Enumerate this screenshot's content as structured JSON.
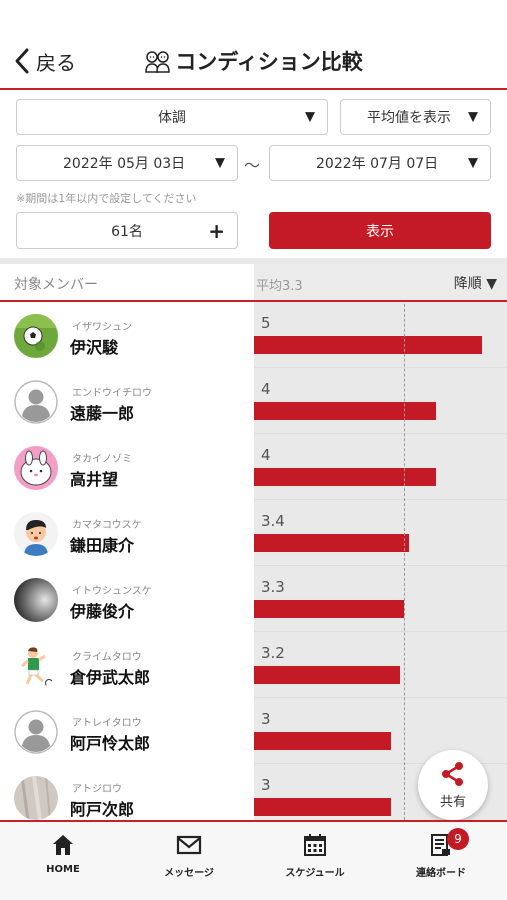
{
  "header": {
    "back_label": "戻る",
    "title": "コンディション比較"
  },
  "filters": {
    "metric": "体調",
    "display_mode": "平均値を表示",
    "date_from": "2022年 05月 03日",
    "date_to": "2022年 07月 07日",
    "separator": "〜",
    "note": "※期間は1年以内で設定してください",
    "members": "61名",
    "show_button": "表示"
  },
  "table": {
    "col_member": "対象メンバー",
    "col_average": "平均3.3",
    "sort_label": "降順 ▼",
    "average": 3.3,
    "max_value": 5
  },
  "members": [
    {
      "kana": "イザワシュン",
      "name": "伊沢駿",
      "value": "5",
      "avatar": "soccer-ball-photo"
    },
    {
      "kana": "エンドウイチロウ",
      "name": "遠藤一郎",
      "value": "4",
      "avatar": "default-person"
    },
    {
      "kana": "タカイノゾミ",
      "name": "高井望",
      "value": "4",
      "avatar": "rabbit-character"
    },
    {
      "kana": "カマタコウスケ",
      "name": "鎌田康介",
      "value": "3.4",
      "avatar": "boy-illustration"
    },
    {
      "kana": "イトウシュンスケ",
      "name": "伊藤俊介",
      "value": "3.3",
      "avatar": "dark-photo"
    },
    {
      "kana": "クライムタロウ",
      "name": "倉伊武太郎",
      "value": "3.2",
      "avatar": "soccer-player-illustration"
    },
    {
      "kana": "アトレイタロウ",
      "name": "阿戸怜太郎",
      "value": "3",
      "avatar": "default-person"
    },
    {
      "kana": "アトジロウ",
      "name": "阿戸次郎",
      "value": "3",
      "avatar": "gray-photo"
    }
  ],
  "share": {
    "label": "共有"
  },
  "tabs": [
    {
      "label": "HOME",
      "icon": "home-icon"
    },
    {
      "label": "メッセージ",
      "icon": "mail-icon"
    },
    {
      "label": "スケジュール",
      "icon": "calendar-icon"
    },
    {
      "label": "連絡ボード",
      "icon": "board-icon",
      "badge": "9"
    }
  ],
  "colors": {
    "accent": "#c41a26",
    "chart_bg": "#e9e9e9"
  }
}
